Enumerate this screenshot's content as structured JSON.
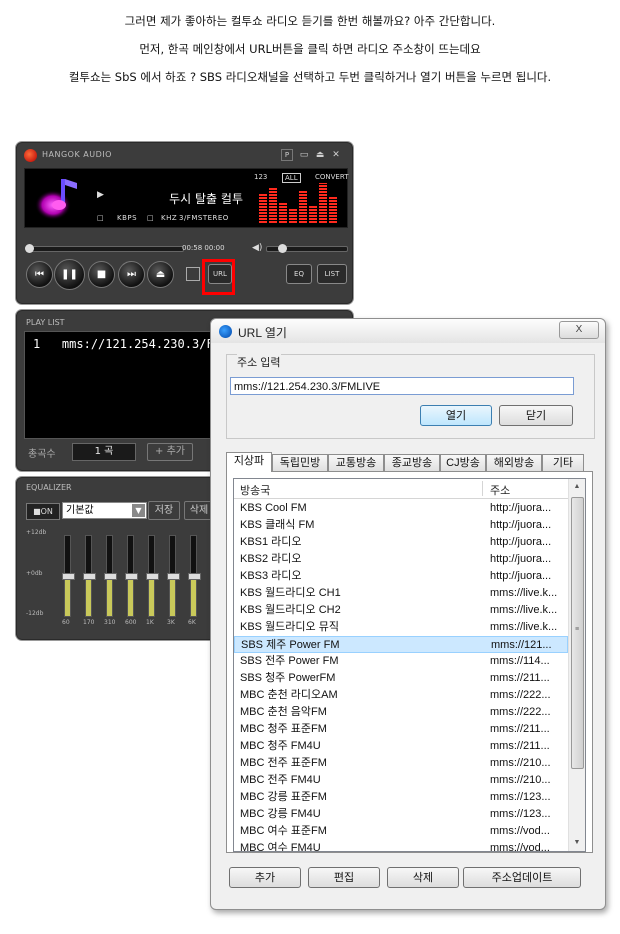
{
  "intro": {
    "line1": "그러면 제가 좋아하는 컬투쇼 라디오 듣기를 한번 해볼까요? 아주 간단합니다.",
    "line2": "먼저, 한곡 메인창에서 URL버튼을 클릭 하면  라디오 주소창이 뜨는데요",
    "line3": "컬투쇼는 SbS 에서 하죠 ?  SBS  라디오채널을 선택하고 두번 클릭하거나 열기 버튼을 누르면 됩니다."
  },
  "player": {
    "app_title": "HANGOK AUDIO",
    "win_p": "P",
    "win_min": "▭",
    "win_eject": "⏏",
    "win_close": "✕",
    "mode_123": "123",
    "mode_all": "ALL",
    "mode_convert": "CONVERT",
    "track": "두시 탈출 컬투",
    "kbps_label": "KBPS",
    "khz_label": "KHZ",
    "format": "3/FMSTEREO",
    "time": "00:58 00:00",
    "btn_prev": "⏮",
    "btn_pause": "❚❚",
    "btn_stop": "■",
    "btn_next": "⏭",
    "btn_eject": "⏏",
    "url_label": "URL",
    "eq_label": "EQ",
    "list_label": "LIST",
    "accent": "#ff0000",
    "seek_position": 0.0,
    "volume": 0.15
  },
  "playlist": {
    "title": "PLAY LIST",
    "item1_index": "1",
    "item1_url": "mms://121.254.230.3/FM",
    "count_label": "총곡수",
    "count_value": "1 곡",
    "add_label": "+ 추가"
  },
  "equalizer": {
    "title": "EQUALIZER",
    "on_label": "■ON",
    "preset": "기본값",
    "save_label": "저장",
    "delete_label": "삭제",
    "scale_top": "+12db",
    "scale_mid": "+0db",
    "scale_bot": "-12db",
    "bands": [
      "60",
      "170",
      "310",
      "600",
      "1K",
      "3K",
      "6K"
    ],
    "band_levels": [
      0.5,
      0.5,
      0.5,
      0.5,
      0.5,
      0.5,
      0.5
    ]
  },
  "dialog": {
    "title": "URL 열기",
    "close_icon_label": "X",
    "group_label": "주소 입력",
    "url_value": "mms://121.254.230.3/FMLIVE",
    "open_label": "열기",
    "close_label": "닫기",
    "tabs": [
      "지상파",
      "독립민방",
      "교통방송",
      "종교방송",
      "CJ방송",
      "해외방송",
      "기타"
    ],
    "col_station": "방송국",
    "col_address": "주소",
    "rows": [
      {
        "name": "KBS  Cool FM",
        "addr": "http://juora..."
      },
      {
        "name": "KBS  클래식 FM",
        "addr": "http://juora..."
      },
      {
        "name": "KBS1 라디오",
        "addr": "http://juora..."
      },
      {
        "name": "KBS2 라디오",
        "addr": "http://juora..."
      },
      {
        "name": "KBS3 라디오",
        "addr": "http://juora..."
      },
      {
        "name": "KBS 월드라디오 CH1",
        "addr": "mms://live.k..."
      },
      {
        "name": "KBS 월드라디오 CH2",
        "addr": "mms://live.k..."
      },
      {
        "name": "KBS 월드라디오 뮤직",
        "addr": "mms://live.k..."
      },
      {
        "name": "SBS  제주 Power FM",
        "addr": "mms://121..."
      },
      {
        "name": "SBS  전주 Power FM",
        "addr": "mms://114..."
      },
      {
        "name": "SBS  청주 PowerFM",
        "addr": "mms://211..."
      },
      {
        "name": "MBC  춘천 라디오AM",
        "addr": "mms://222..."
      },
      {
        "name": "MBC  춘천 음악FM",
        "addr": "mms://222..."
      },
      {
        "name": "MBC  청주 표준FM",
        "addr": "mms://211..."
      },
      {
        "name": "MBC  청주 FM4U",
        "addr": "mms://211..."
      },
      {
        "name": "MBC  전주 표준FM",
        "addr": "mms://210..."
      },
      {
        "name": "MBC  전주 FM4U",
        "addr": "mms://210..."
      },
      {
        "name": "MBC  강릉 표준FM",
        "addr": "mms://123..."
      },
      {
        "name": "MBC  강릉 FM4U",
        "addr": "mms://123..."
      },
      {
        "name": "MBC  여수 표준FM",
        "addr": "mms://vod..."
      },
      {
        "name": "MBC  여수 FM4U",
        "addr": "mms://vod..."
      }
    ],
    "selected_row": "SBS  제주 Power FM",
    "btn_add": "추가",
    "btn_edit": "편집",
    "btn_delete": "삭제",
    "btn_update": "주소업데이트"
  }
}
